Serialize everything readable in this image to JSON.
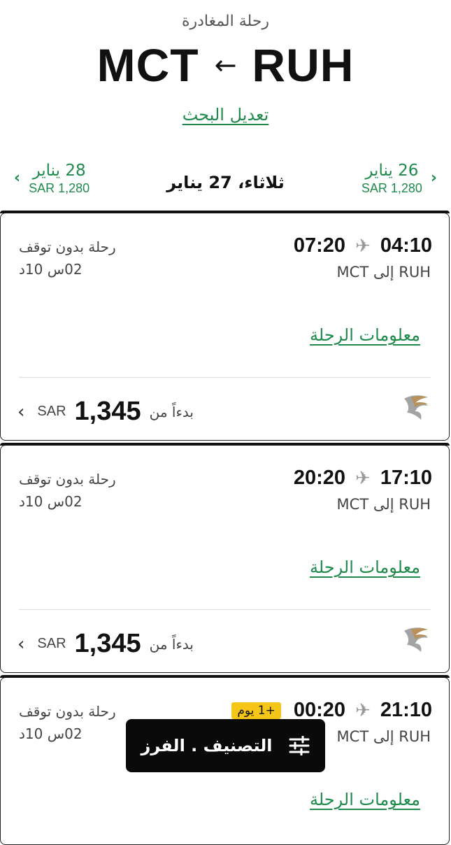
{
  "header": {
    "subtitle": "رحلة المغادرة",
    "origin": "RUH",
    "destination": "MCT",
    "arrow": "←",
    "modify_search": "تعديل البحث"
  },
  "date_bar": {
    "prev": {
      "date": "26 يناير",
      "price": "SAR 1,280"
    },
    "current": "ثلاثاء، 27 يناير",
    "next": {
      "date": "28 يناير",
      "price": "SAR 1,280"
    }
  },
  "flights": [
    {
      "depart": "04:10",
      "arrive": "07:20",
      "badge": "",
      "leg": "RUH إلى MCT",
      "stops": "رحلة بدون توقف",
      "duration": "02س 10د",
      "info_link": "معلومات الرحلة",
      "from_label": "بدءاً من",
      "amount": "1,345",
      "currency": "SAR"
    },
    {
      "depart": "17:10",
      "arrive": "20:20",
      "badge": "",
      "leg": "RUH إلى MCT",
      "stops": "رحلة بدون توقف",
      "duration": "02س 10د",
      "info_link": "معلومات الرحلة",
      "from_label": "بدءاً من",
      "amount": "1,345",
      "currency": "SAR"
    },
    {
      "depart": "21:10",
      "arrive": "00:20",
      "badge": "+1 يوم",
      "leg": "RUH إلى MCT",
      "stops": "رحلة بدون توقف",
      "duration": "02س 10د",
      "info_link": "معلومات الرحلة",
      "from_label": "",
      "amount": "",
      "currency": ""
    }
  ],
  "sort_filter": {
    "label": "التصنيف . الفرز"
  },
  "colors": {
    "accent": "#1f8a4c",
    "badge": "#f5c518",
    "pill": "#0a0a0a"
  },
  "icons": {
    "plane": "plane-icon",
    "chevron": "chevron-icon",
    "airline_logo": "oman-air-logo",
    "sliders": "sliders-icon"
  }
}
